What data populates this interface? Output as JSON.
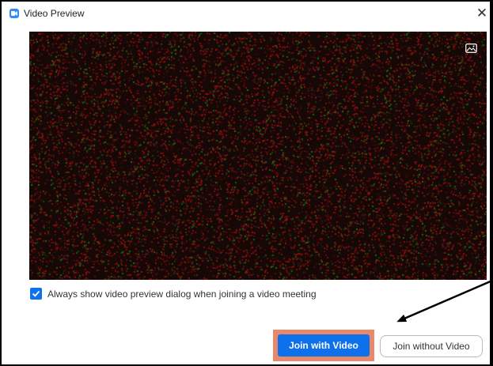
{
  "window": {
    "title": "Video Preview",
    "close_glyph": "✕"
  },
  "video": {
    "background_icon": "background-image-icon"
  },
  "preview_option": {
    "checked": true,
    "label": "Always show video preview dialog when joining a video meeting"
  },
  "buttons": {
    "join_with_video": "Join with Video",
    "join_without_video": "Join without Video"
  },
  "colors": {
    "accent": "#0e71eb",
    "highlight_border": "#e9896b",
    "video_background": "#150807"
  },
  "icons": {
    "app": "zoom-camera-icon",
    "close": "close-icon",
    "checkbox": "checkmark-icon",
    "annotation": "arrow-icon"
  }
}
